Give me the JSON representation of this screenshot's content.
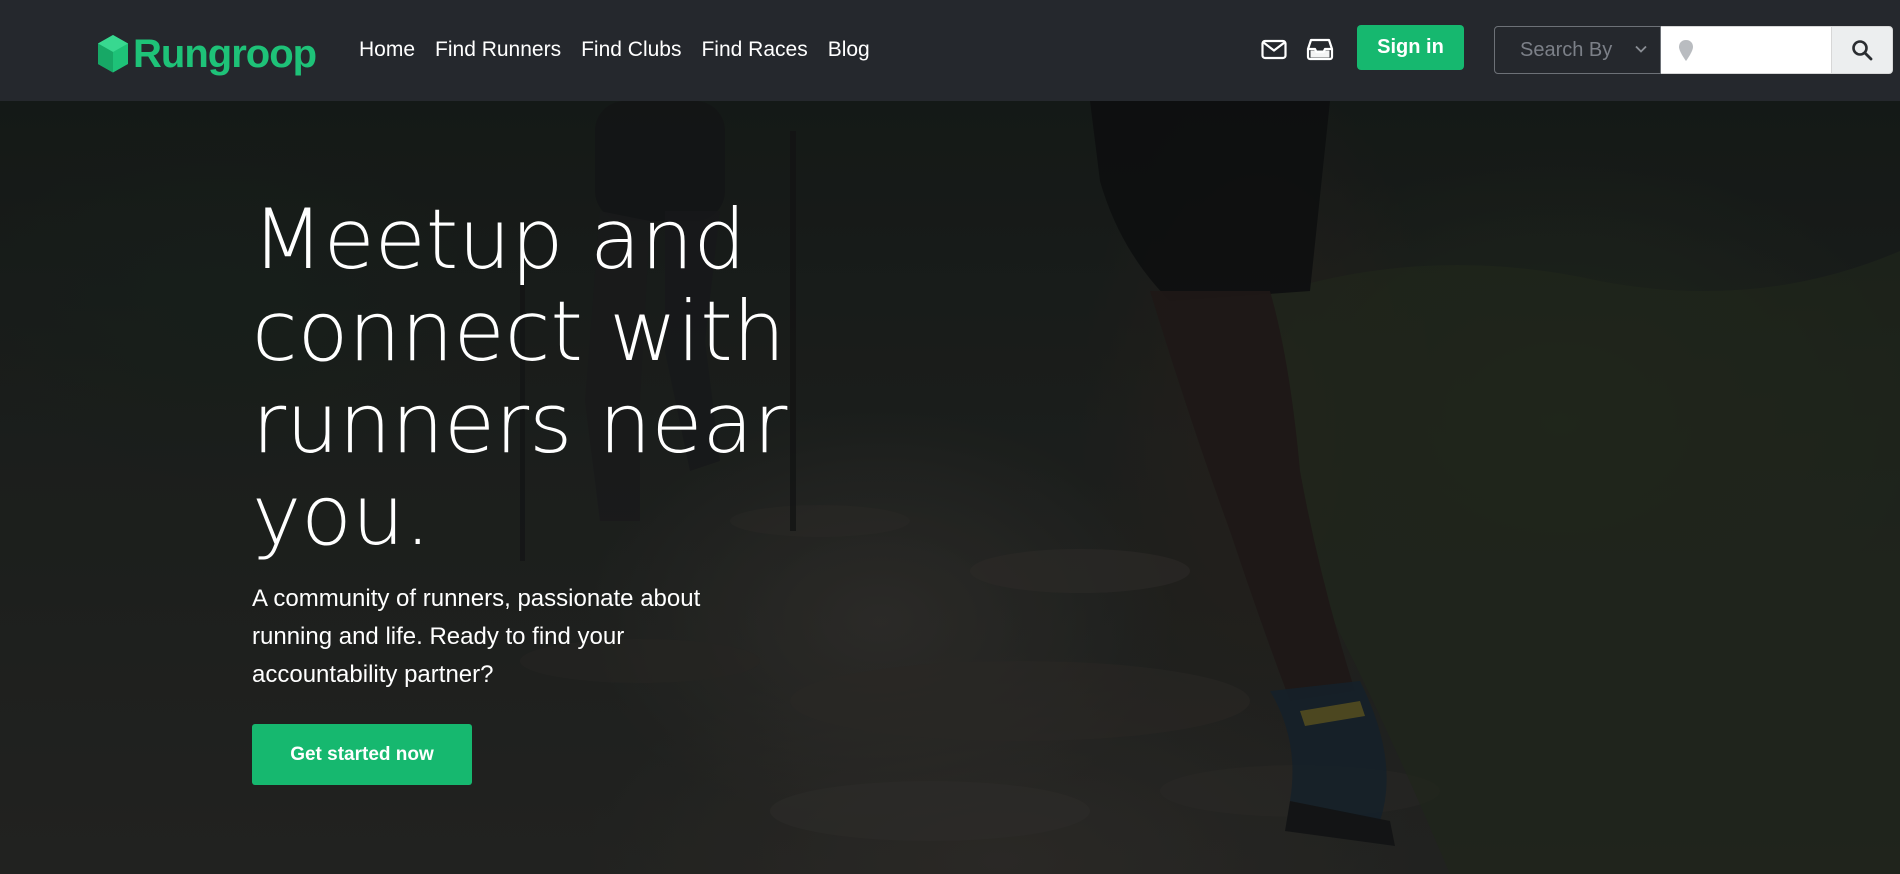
{
  "brand": {
    "name": "Rungroop",
    "logo_icon": "hexagon-logo-icon",
    "color": "#1ec278"
  },
  "nav": {
    "links": [
      {
        "label": "Home"
      },
      {
        "label": "Find Runners"
      },
      {
        "label": "Find Clubs"
      },
      {
        "label": "Find Races"
      },
      {
        "label": "Blog"
      }
    ],
    "icons": [
      "mail-icon",
      "inbox-icon"
    ],
    "signin_label": "Sign in"
  },
  "search": {
    "select_label": "Search By",
    "input_placeholder": "",
    "location_icon": "map-pin-icon",
    "submit_icon": "search-icon"
  },
  "hero": {
    "title": "Meetup and connect with runners near you.",
    "subtitle": "A community of runners, passionate about running and life. Ready to find your accountability partner?",
    "cta_label": "Get started now"
  },
  "colors": {
    "accent": "#16b86f",
    "navbar_bg": "#25282d",
    "text": "#ffffff"
  }
}
